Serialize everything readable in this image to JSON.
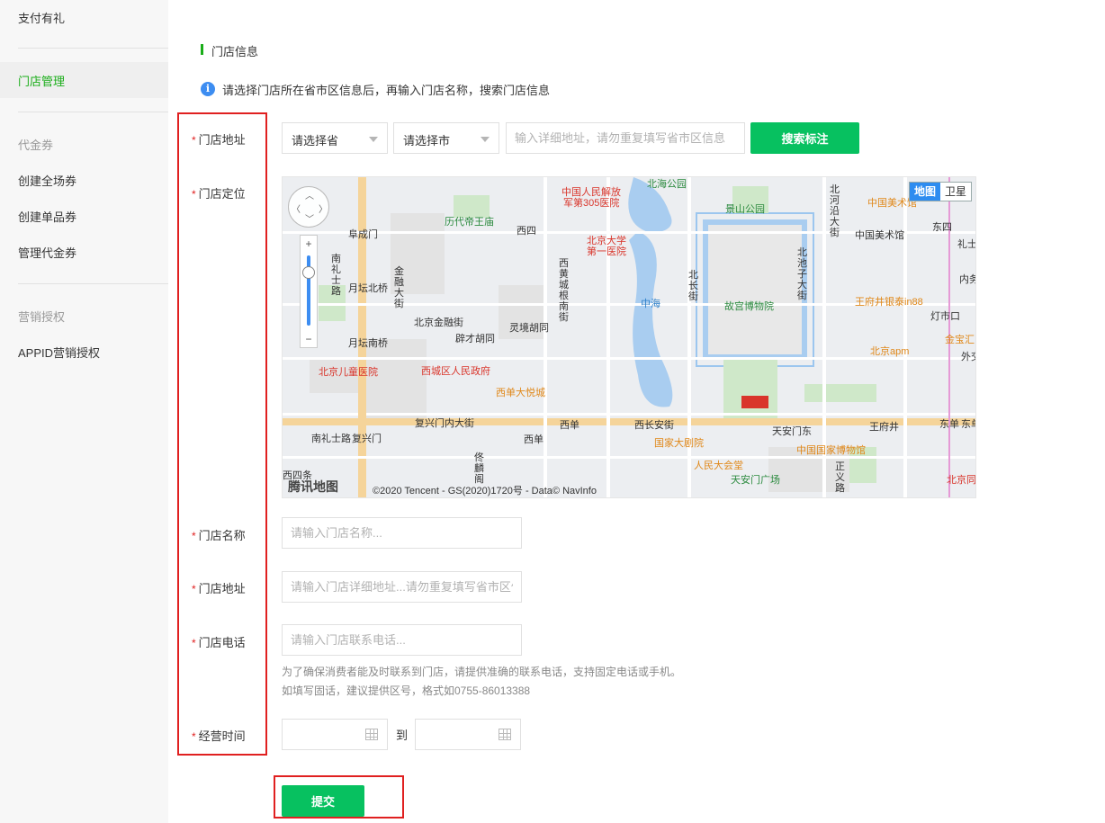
{
  "sidebar": {
    "items": [
      {
        "label": "支付有礼"
      },
      {
        "label": "门店管理"
      },
      {
        "label": "代金券"
      },
      {
        "label": "创建全场券"
      },
      {
        "label": "创建单品券"
      },
      {
        "label": "管理代金券"
      },
      {
        "label": "营销授权"
      },
      {
        "label": "APPID营销授权"
      }
    ]
  },
  "section": {
    "title": "门店信息",
    "info": "请选择门店所在省市区信息后，再输入门店名称，搜索门店信息"
  },
  "form": {
    "address_label": "门店地址",
    "province_value": "请选择省",
    "city_value": "请选择市",
    "detail_placeholder": "输入详细地址，请勿重复填写省市区信息",
    "search_button": "搜索标注",
    "location_label": "门店定位",
    "name_label": "门店名称",
    "name_placeholder": "请输入门店名称...",
    "store_address_label": "门店地址",
    "store_address_placeholder": "请输入门店详细地址...请勿重复填写省市区信息",
    "phone_label": "门店电话",
    "phone_placeholder": "请输入门店联系电话...",
    "phone_hint_1": "为了确保消费者能及时联系到门店，请提供准确的联系电话，支持固定电话或手机。",
    "phone_hint_2": "如填写固话，建议提供区号，格式如0755-86013388",
    "hours_label": "经营时间",
    "to_text": "到",
    "submit_button": "提交"
  },
  "map": {
    "type_map": "地图",
    "type_satellite": "卫星",
    "logo": "腾讯地图",
    "copyright": "©2020 Tencent - GS(2020)1720号 - Data© NavInfo",
    "labels": [
      {
        "text": "北海公园",
        "cls": "mt-green"
      },
      {
        "text": "中国人民解放",
        "cls": "mt-red"
      },
      {
        "text": "军第305医院",
        "cls": "mt-red"
      },
      {
        "text": "景山公园",
        "cls": "mt-green"
      },
      {
        "text": "中国美术馆",
        "cls": "mt-orange"
      },
      {
        "text": "中国美术馆",
        "cls": "mt-dark"
      },
      {
        "text": "历代帝王庙",
        "cls": "mt-green"
      },
      {
        "text": "北京大学",
        "cls": "mt-red"
      },
      {
        "text": "第一医院",
        "cls": "mt-red"
      },
      {
        "text": "阜成门",
        "cls": "mt-dark"
      },
      {
        "text": "西四",
        "cls": "mt-dark"
      },
      {
        "text": "东四",
        "cls": "mt-dark"
      },
      {
        "text": "礼士",
        "cls": "mt-dark"
      },
      {
        "text": "月坛北桥",
        "cls": "mt-dark"
      },
      {
        "text": "中海",
        "cls": "mt-blue"
      },
      {
        "text": "故宫博物院",
        "cls": "mt-green"
      },
      {
        "text": "王府井银泰in88",
        "cls": "mt-orange"
      },
      {
        "text": "灯市口",
        "cls": "mt-dark"
      },
      {
        "text": "内务",
        "cls": "mt-dark"
      },
      {
        "text": "北京金融街",
        "cls": "mt-dark"
      },
      {
        "text": "灵境胡同",
        "cls": "mt-dark"
      },
      {
        "text": "辟才胡同",
        "cls": "mt-dark"
      },
      {
        "text": "月坛南桥",
        "cls": "mt-dark"
      },
      {
        "text": "北京apm",
        "cls": "mt-orange"
      },
      {
        "text": "金宝汇",
        "cls": "mt-orange"
      },
      {
        "text": "外交",
        "cls": "mt-dark"
      },
      {
        "text": "北京儿童医院",
        "cls": "mt-red"
      },
      {
        "text": "西城区人民政府",
        "cls": "mt-red"
      },
      {
        "text": "西单大悦城",
        "cls": "mt-orange"
      },
      {
        "text": "复兴门内大街",
        "cls": "mt-dark"
      },
      {
        "text": "西单",
        "cls": "mt-dark"
      },
      {
        "text": "西长安街",
        "cls": "mt-dark"
      },
      {
        "text": "天安门东",
        "cls": "mt-dark"
      },
      {
        "text": "王府井",
        "cls": "mt-dark"
      },
      {
        "text": "东单",
        "cls": "mt-dark"
      },
      {
        "text": "东单",
        "cls": "mt-dark"
      },
      {
        "text": "南礼士路",
        "cls": "mt-dark"
      },
      {
        "text": "复兴门",
        "cls": "mt-dark"
      },
      {
        "text": "西单",
        "cls": "mt-dark"
      },
      {
        "text": "国家大剧院",
        "cls": "mt-orange"
      },
      {
        "text": "中国国家博物馆",
        "cls": "mt-orange"
      },
      {
        "text": "人民大会堂",
        "cls": "mt-orange"
      },
      {
        "text": "天安门广场",
        "cls": "mt-green"
      },
      {
        "text": "北京同",
        "cls": "mt-red"
      },
      {
        "text": "西四条",
        "cls": "mt-dark"
      }
    ],
    "vlabels": [
      {
        "text": "南礼士路"
      },
      {
        "text": "金融大街"
      },
      {
        "text": "西黄城根南街"
      },
      {
        "text": "北长街"
      },
      {
        "text": "北池子大街"
      },
      {
        "text": "北河沿大街"
      },
      {
        "text": "佟麟阁"
      },
      {
        "text": "正义路"
      }
    ]
  }
}
